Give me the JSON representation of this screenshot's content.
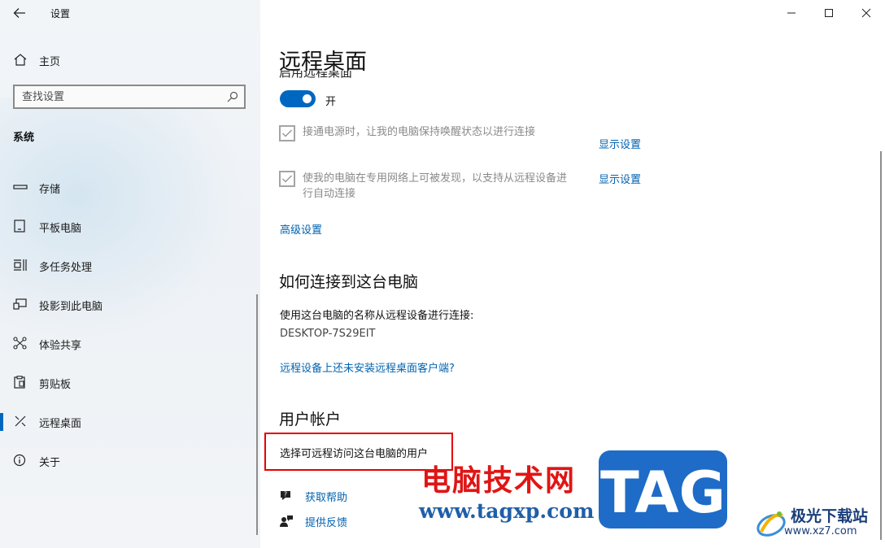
{
  "window": {
    "app_title": "设置",
    "controls": {
      "minimize_icon": "minimize-icon",
      "maximize_icon": "maximize-icon",
      "close_icon": "close-icon"
    }
  },
  "sidebar": {
    "home_label": "主页",
    "search_placeholder": "查找设置",
    "section_label": "系统",
    "items": [
      {
        "label": "存储",
        "icon": "storage-icon",
        "selected": false
      },
      {
        "label": "平板电脑",
        "icon": "tablet-icon",
        "selected": false
      },
      {
        "label": "多任务处理",
        "icon": "multitasking-icon",
        "selected": false
      },
      {
        "label": "投影到此电脑",
        "icon": "projecting-icon",
        "selected": false
      },
      {
        "label": "体验共享",
        "icon": "shared-experiences-icon",
        "selected": false
      },
      {
        "label": "剪贴板",
        "icon": "clipboard-icon",
        "selected": false
      },
      {
        "label": "远程桌面",
        "icon": "remote-desktop-icon",
        "selected": true
      },
      {
        "label": "关于",
        "icon": "info-icon",
        "selected": false
      }
    ]
  },
  "main": {
    "title": "远程桌面",
    "enable_heading": "启用远程桌面",
    "toggle": {
      "label": "开",
      "on": true
    },
    "checkboxes": [
      {
        "text": "接通电源时，让我的电脑保持唤醒状态以进行连接",
        "checked": true,
        "link": "显示设置"
      },
      {
        "text_line1": "使我的电脑在专用网络上可被发现，以支持从远程设备进",
        "text_line2": "行自动连接",
        "checked": true,
        "link": "显示设置"
      }
    ],
    "advanced_link": "高级设置",
    "connect_section": {
      "heading": "如何连接到这台电脑",
      "description": "使用这台电脑的名称从远程设备进行连接:",
      "pc_name": "DESKTOP-7S29EIT",
      "client_link": "远程设备上还未安装远程桌面客户端?"
    },
    "accounts_section": {
      "heading": "用户帐户",
      "select_link": "选择可远程访问这台电脑的用户"
    },
    "help": [
      {
        "label": "获取帮助",
        "icon": "get-help-icon"
      },
      {
        "label": "提供反馈",
        "icon": "feedback-icon"
      }
    ]
  },
  "watermark": {
    "site_name": "电脑技术网",
    "site_url": "www.tagxp.com",
    "tag_text": "TAG",
    "logo_title": "极光下载站",
    "logo_url": "www.xz7.com"
  },
  "colors": {
    "accent": "#0067c0",
    "link": "#0063b1",
    "highlight_box": "#e60000",
    "watermark_red": "#e01515",
    "watermark_blue": "#1e6cc8"
  }
}
